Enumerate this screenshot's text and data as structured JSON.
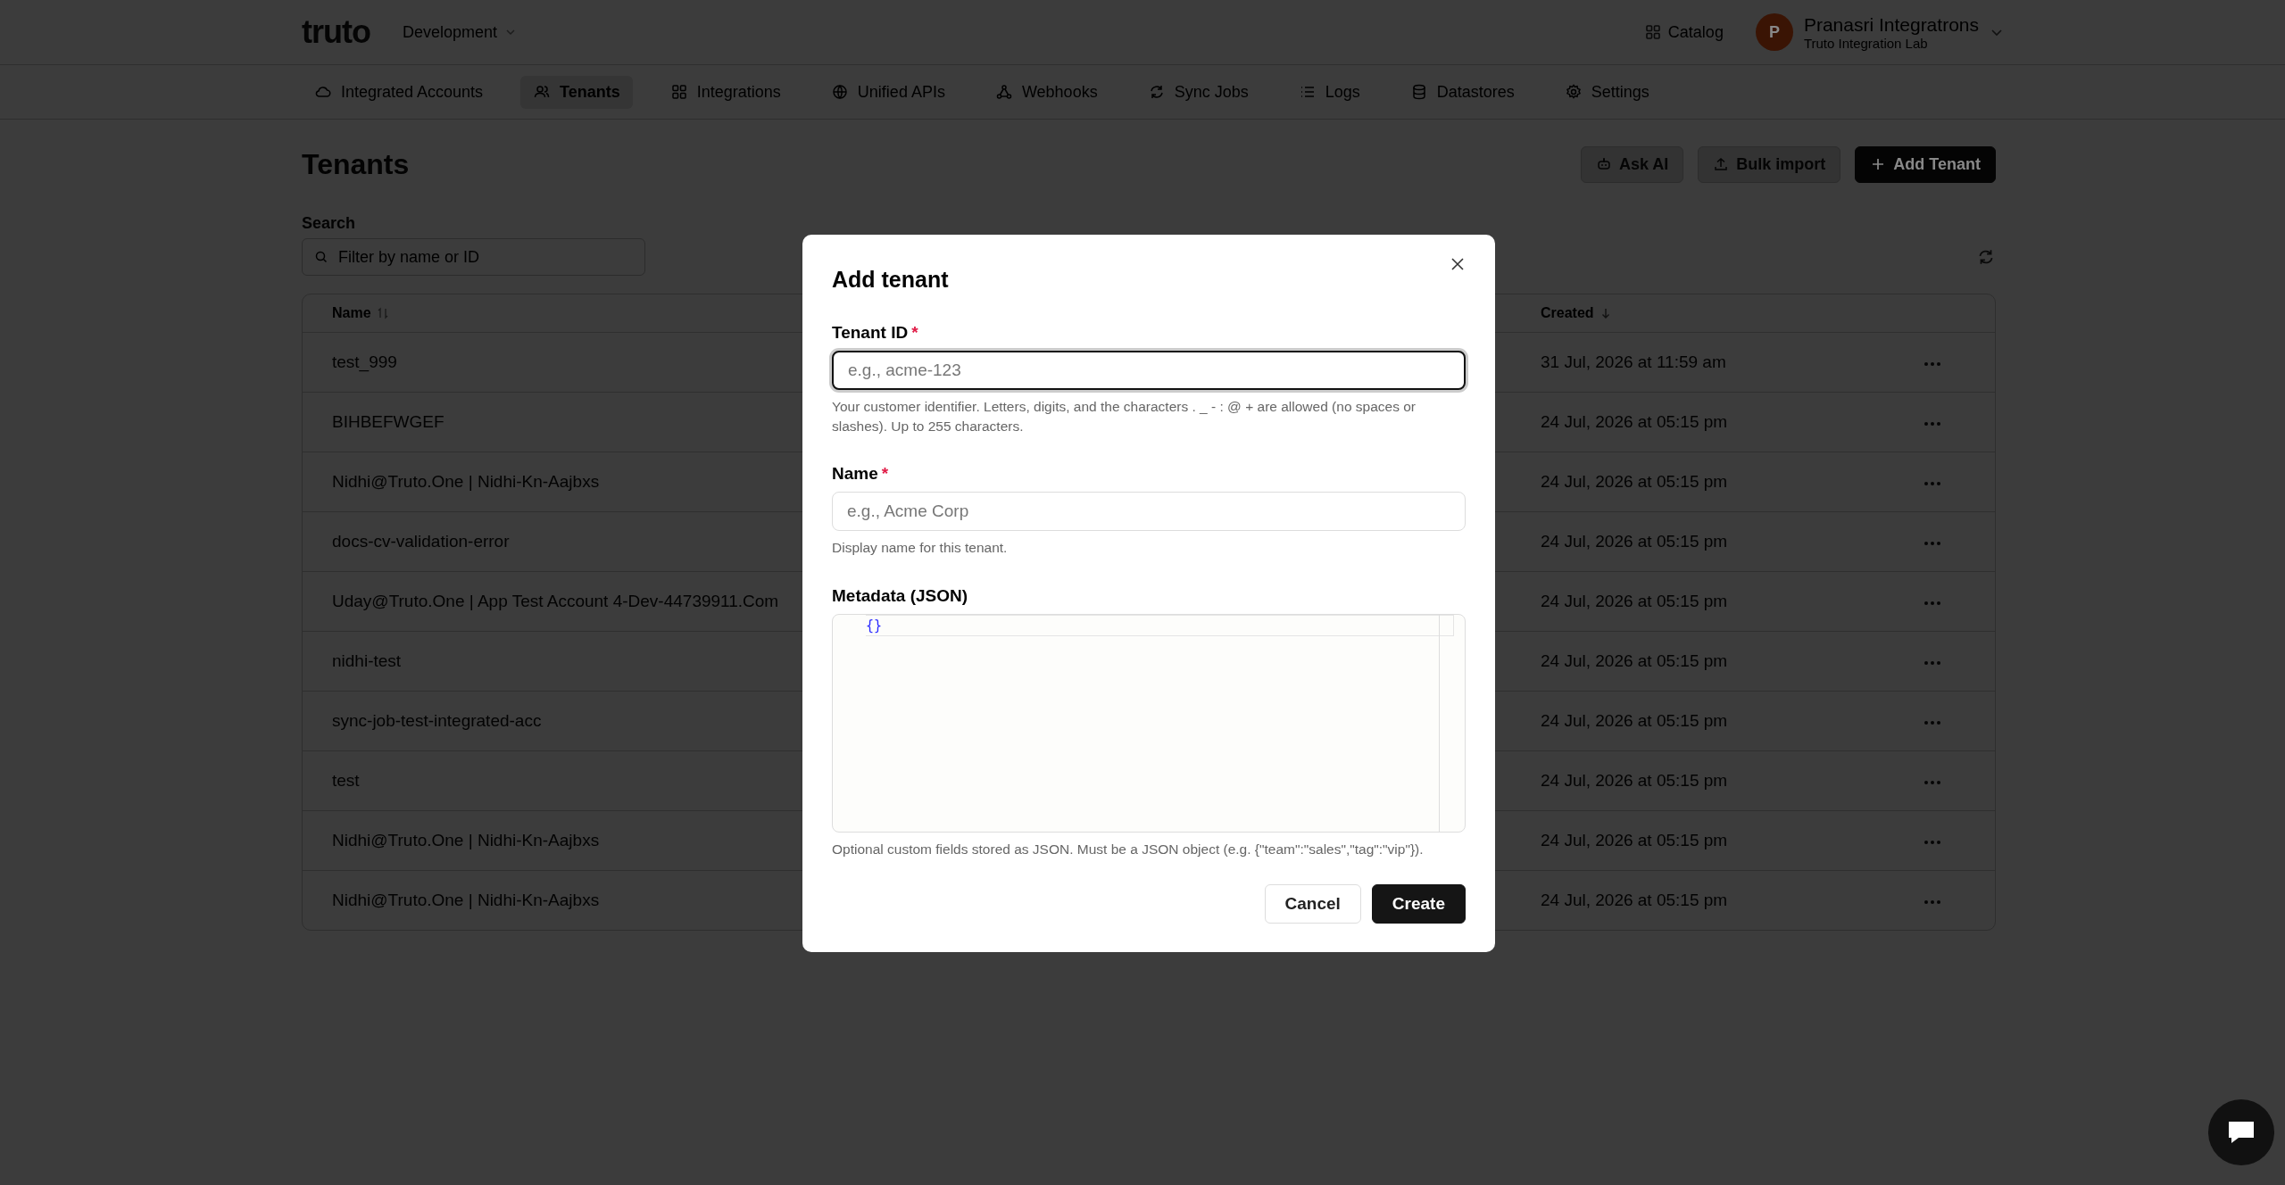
{
  "header": {
    "logo": "truto",
    "environment": "Development",
    "catalog": "Catalog",
    "user": {
      "initial": "P",
      "name": "Pranasri Integratrons",
      "org": "Truto Integration Lab"
    }
  },
  "nav": [
    {
      "label": "Integrated Accounts",
      "selected": false
    },
    {
      "label": "Tenants",
      "selected": true
    },
    {
      "label": "Integrations",
      "selected": false
    },
    {
      "label": "Unified APIs",
      "selected": false
    },
    {
      "label": "Webhooks",
      "selected": false
    },
    {
      "label": "Sync Jobs",
      "selected": false
    },
    {
      "label": "Logs",
      "selected": false
    },
    {
      "label": "Datastores",
      "selected": false
    },
    {
      "label": "Settings",
      "selected": false
    }
  ],
  "page": {
    "title": "Tenants",
    "actions": [
      {
        "label": "Ask AI",
        "kind": "ai"
      },
      {
        "label": "Bulk import",
        "kind": "upload"
      },
      {
        "label": "Add Tenant",
        "kind": "add"
      }
    ],
    "search": {
      "label": "Search",
      "placeholder": "Filter by name or ID"
    }
  },
  "table": {
    "columns": [
      {
        "label": "Name",
        "kind": "both"
      },
      {
        "label": "Created",
        "kind": "down"
      }
    ],
    "rows": [
      {
        "name": "test_999",
        "created": "31 Jul, 2026 at 11:59 am"
      },
      {
        "name": "BIHBEFWGEF",
        "created": "24 Jul, 2026 at 05:15 pm"
      },
      {
        "name": "Nidhi@Truto.One | Nidhi-Kn-Aajbxs",
        "created": "24 Jul, 2026 at 05:15 pm"
      },
      {
        "name": "docs-cv-validation-error",
        "created": "24 Jul, 2026 at 05:15 pm"
      },
      {
        "name": "Uday@Truto.One | App Test Account 4-Dev-44739911.Com",
        "created": "24 Jul, 2026 at 05:15 pm"
      },
      {
        "name": "nidhi-test",
        "created": "24 Jul, 2026 at 05:15 pm"
      },
      {
        "name": "sync-job-test-integrated-acc",
        "created": "24 Jul, 2026 at 05:15 pm"
      },
      {
        "name": "test",
        "created": "24 Jul, 2026 at 05:15 pm"
      },
      {
        "name": "Nidhi@Truto.One | Nidhi-Kn-Aajbxs",
        "created": "24 Jul, 2026 at 05:15 pm"
      },
      {
        "name": "Nidhi@Truto.One | Nidhi-Kn-Aajbxs",
        "created": "24 Jul, 2026 at 05:15 pm"
      }
    ]
  },
  "dialog": {
    "title": "Add tenant",
    "fields": [
      {
        "kind": "input",
        "label": "Tenant ID",
        "required_mark": "*",
        "placeholder": "e.g., acme-123",
        "focused": true,
        "help": "Your customer identifier. Letters, digits, and the characters . _ - : @ + are allowed (no spaces or slashes). Up to 255 characters."
      },
      {
        "kind": "input",
        "label": "Name",
        "required_mark": "*",
        "placeholder": "e.g., Acme Corp",
        "focused": false,
        "help": "Display name for this tenant."
      },
      {
        "kind": "code",
        "label": "Metadata (JSON)",
        "value": "{}",
        "help": "Optional custom fields stored as JSON. Must be a JSON object (e.g. {\"team\":\"sales\",\"tag\":\"vip\"})."
      }
    ],
    "buttons": [
      {
        "label": "Cancel",
        "kind": "secondary"
      },
      {
        "label": "Create",
        "kind": "primary"
      }
    ]
  }
}
